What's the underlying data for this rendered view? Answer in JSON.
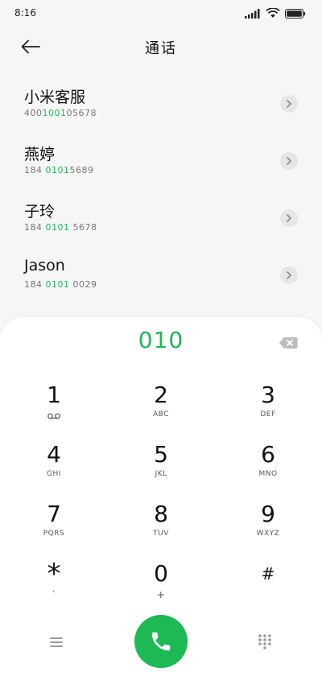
{
  "status": {
    "time": "8:16"
  },
  "header": {
    "title": "通话"
  },
  "contacts": [
    {
      "name": "小米客服",
      "number_pre": "400",
      "number_hl": "1001",
      "number_post": "0567",
      "number_post2": "8"
    },
    {
      "name": "燕婷",
      "number_pre": "184 ",
      "number_hl": "0101",
      "number_post": "5689",
      "number_post2": ""
    },
    {
      "name": "子玲",
      "number_pre": "184 ",
      "number_hl": "0101",
      "number_post": " 5678",
      "number_post2": ""
    },
    {
      "name": "Jason",
      "number_pre": "184 ",
      "number_hl": "0101",
      "number_post": " 0029",
      "number_post2": ""
    }
  ],
  "dialer": {
    "input": "010",
    "keys": [
      {
        "digit": "1",
        "letters": ""
      },
      {
        "digit": "2",
        "letters": "ABC"
      },
      {
        "digit": "3",
        "letters": "DEF"
      },
      {
        "digit": "4",
        "letters": "GHI"
      },
      {
        "digit": "5",
        "letters": "JKL"
      },
      {
        "digit": "6",
        "letters": "MNO"
      },
      {
        "digit": "7",
        "letters": "PQRS"
      },
      {
        "digit": "8",
        "letters": "TUV"
      },
      {
        "digit": "9",
        "letters": "WXYZ"
      },
      {
        "digit": "*",
        "letters": ","
      },
      {
        "digit": "0",
        "letters": "+"
      },
      {
        "digit": "#",
        "letters": ""
      }
    ]
  },
  "colors": {
    "accent": "#1db954",
    "panel": "#ffffff",
    "background": "#f6f6f6"
  },
  "icons": {
    "back": "arrow-left-icon",
    "voicemail": "voicemail-icon",
    "backspace": "backspace-icon",
    "menu": "menu-icon",
    "call": "phone-icon",
    "dialpad": "dialpad-icon"
  }
}
